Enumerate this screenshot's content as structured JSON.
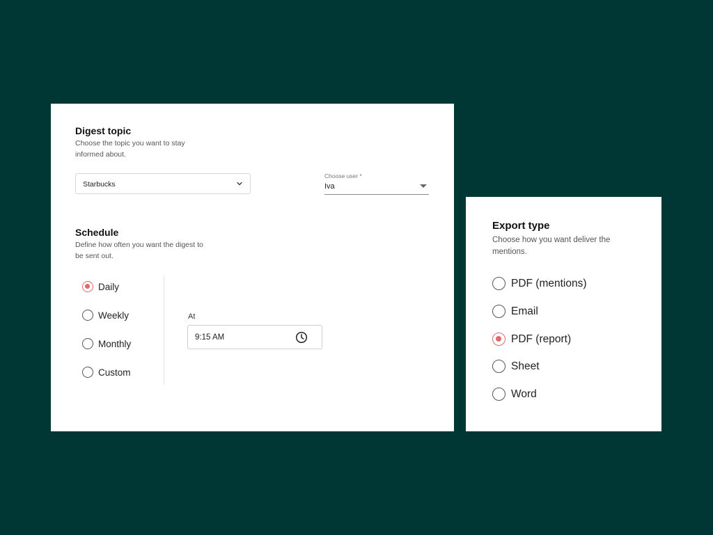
{
  "digest": {
    "topic_title": "Digest topic",
    "topic_desc_line1": "Choose the topic you want to stay",
    "topic_desc_line2": "informed about.",
    "topic_value": "Starbucks",
    "user_label": "Choose user *",
    "user_value": "Iva",
    "schedule_title": "Schedule",
    "schedule_desc_line1": "Define how often you want the digest to",
    "schedule_desc_line2": "be sent out.",
    "frequency_options": [
      {
        "label": "Daily",
        "checked": true
      },
      {
        "label": "Weekly",
        "checked": false
      },
      {
        "label": "Monthly",
        "checked": false
      },
      {
        "label": "Custom",
        "checked": false
      }
    ],
    "at_label": "At",
    "time_value": "9:15 AM"
  },
  "export": {
    "title": "Export type",
    "desc_line1": "Choose how you want deliver the",
    "desc_line2": "mentions.",
    "options": [
      {
        "label": "PDF (mentions)",
        "checked": false
      },
      {
        "label": "Email",
        "checked": false
      },
      {
        "label": "PDF (report)",
        "checked": true
      },
      {
        "label": "Sheet",
        "checked": false
      },
      {
        "label": "Word",
        "checked": false
      }
    ]
  },
  "colors": {
    "background": "#003734",
    "card": "#ffffff",
    "accent": "#e06a6a"
  },
  "icons": {
    "topic_dropdown": "chevron-down-icon",
    "user_dropdown": "caret-down-icon",
    "time_picker": "clock-icon"
  }
}
